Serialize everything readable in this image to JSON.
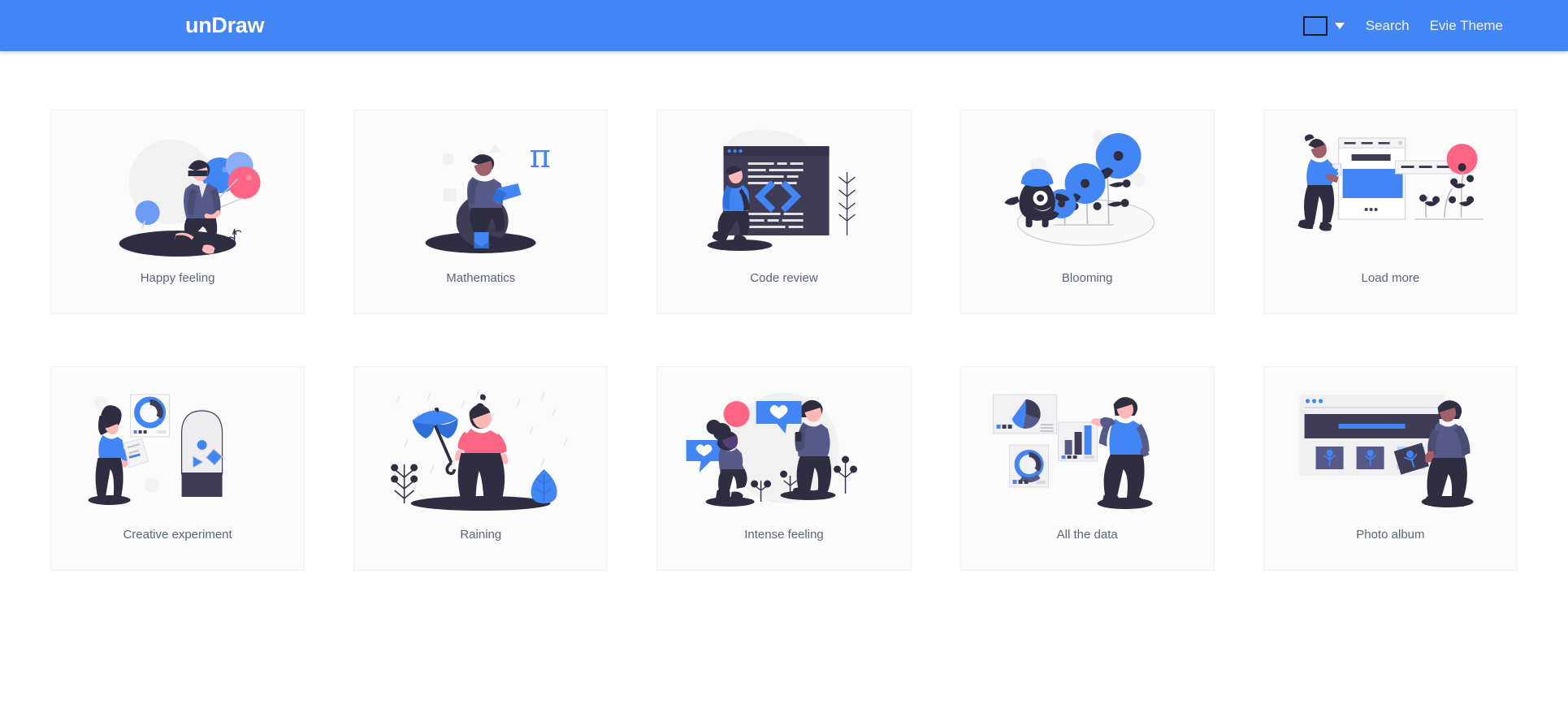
{
  "header": {
    "brand": "unDraw",
    "color_swatch": {
      "name": "color-picker-swatch",
      "value": "#4285f4",
      "border": "#1b1b2c"
    },
    "caret_icon": "chevron-down-icon",
    "links": [
      {
        "label": "Search",
        "name": "search"
      },
      {
        "label": "Evie Theme",
        "name": "evie-theme"
      }
    ],
    "background": "#4285f4",
    "text_color": "#ffffff"
  },
  "theme": {
    "accent_blue": "#4285f4",
    "dark_navy": "#3f3d56",
    "deep_navy": "#2f2e41",
    "pink": "#fd6584",
    "card_bg": "#fbfbfc",
    "card_border": "#f0f0f2",
    "label_color": "#5b6475",
    "page_bg": "#ffffff"
  },
  "gallery": {
    "columns": 5,
    "items": [
      {
        "label": "Happy feeling",
        "name": "happy-feeling",
        "art": "woman-walking-with-balloons"
      },
      {
        "label": "Mathematics",
        "name": "mathematics",
        "art": "person-reading-book-with-pi-symbol"
      },
      {
        "label": "Code review",
        "name": "code-review",
        "art": "code-window-with-angle-brackets-and-person"
      },
      {
        "label": "Blooming",
        "name": "blooming",
        "art": "character-with-blue-flowers"
      },
      {
        "label": "Load more",
        "name": "load-more",
        "art": "woman-with-browser-window-and-plants"
      },
      {
        "label": "Creative experiment",
        "name": "creative-experiment",
        "art": "woman-with-chart-card-and-dome"
      },
      {
        "label": "Raining",
        "name": "raining",
        "art": "woman-with-blue-umbrella-in-rain"
      },
      {
        "label": "Intense feeling",
        "name": "intense-feeling",
        "art": "two-people-with-heart-speech-bubbles"
      },
      {
        "label": "All the data",
        "name": "all-the-data",
        "art": "man-with-pie-donut-and-bar-charts"
      },
      {
        "label": "Photo album",
        "name": "photo-album",
        "art": "man-arranging-photos-in-browser"
      }
    ]
  }
}
